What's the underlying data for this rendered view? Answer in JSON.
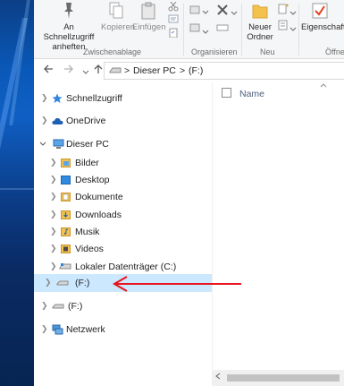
{
  "ribbon": {
    "groups": [
      {
        "name": "Zwischenablage"
      },
      {
        "name": "Organisieren"
      },
      {
        "name": "Neu"
      },
      {
        "name": "Öffnen"
      }
    ],
    "buttons": {
      "pin": "An Schnellzugriff anheften",
      "copy": "Kopieren",
      "paste": "Einfügen",
      "new_folder": "Neuer Ordner",
      "properties": "Eigenschaften"
    }
  },
  "address": {
    "crumbs": [
      "Dieser PC",
      "(F:)"
    ],
    "separator": ">"
  },
  "nav": {
    "items": [
      {
        "label": "Schnellzugriff",
        "icon": "star-icon"
      },
      {
        "label": "OneDrive",
        "icon": "cloud-icon"
      },
      {
        "label": "Dieser PC",
        "icon": "pc-icon"
      },
      {
        "label": "Bilder",
        "icon": "pictures-folder-icon"
      },
      {
        "label": "Desktop",
        "icon": "desktop-folder-icon"
      },
      {
        "label": "Dokumente",
        "icon": "documents-folder-icon"
      },
      {
        "label": "Downloads",
        "icon": "downloads-folder-icon"
      },
      {
        "label": "Musik",
        "icon": "music-folder-icon"
      },
      {
        "label": "Videos",
        "icon": "videos-folder-icon"
      },
      {
        "label": "Lokaler Datenträger (C:)",
        "icon": "drive-icon"
      },
      {
        "label": "(F:)",
        "icon": "usb-drive-icon"
      },
      {
        "label": "(F:)",
        "icon": "usb-drive-icon"
      },
      {
        "label": "Netzwerk",
        "icon": "network-icon"
      }
    ]
  },
  "content": {
    "column_name": "Name"
  },
  "colors": {
    "selection": "#cce8ff",
    "annotation_arrow": "#e8141e",
    "star": "#2e86de",
    "folder": "#f2c14e"
  }
}
